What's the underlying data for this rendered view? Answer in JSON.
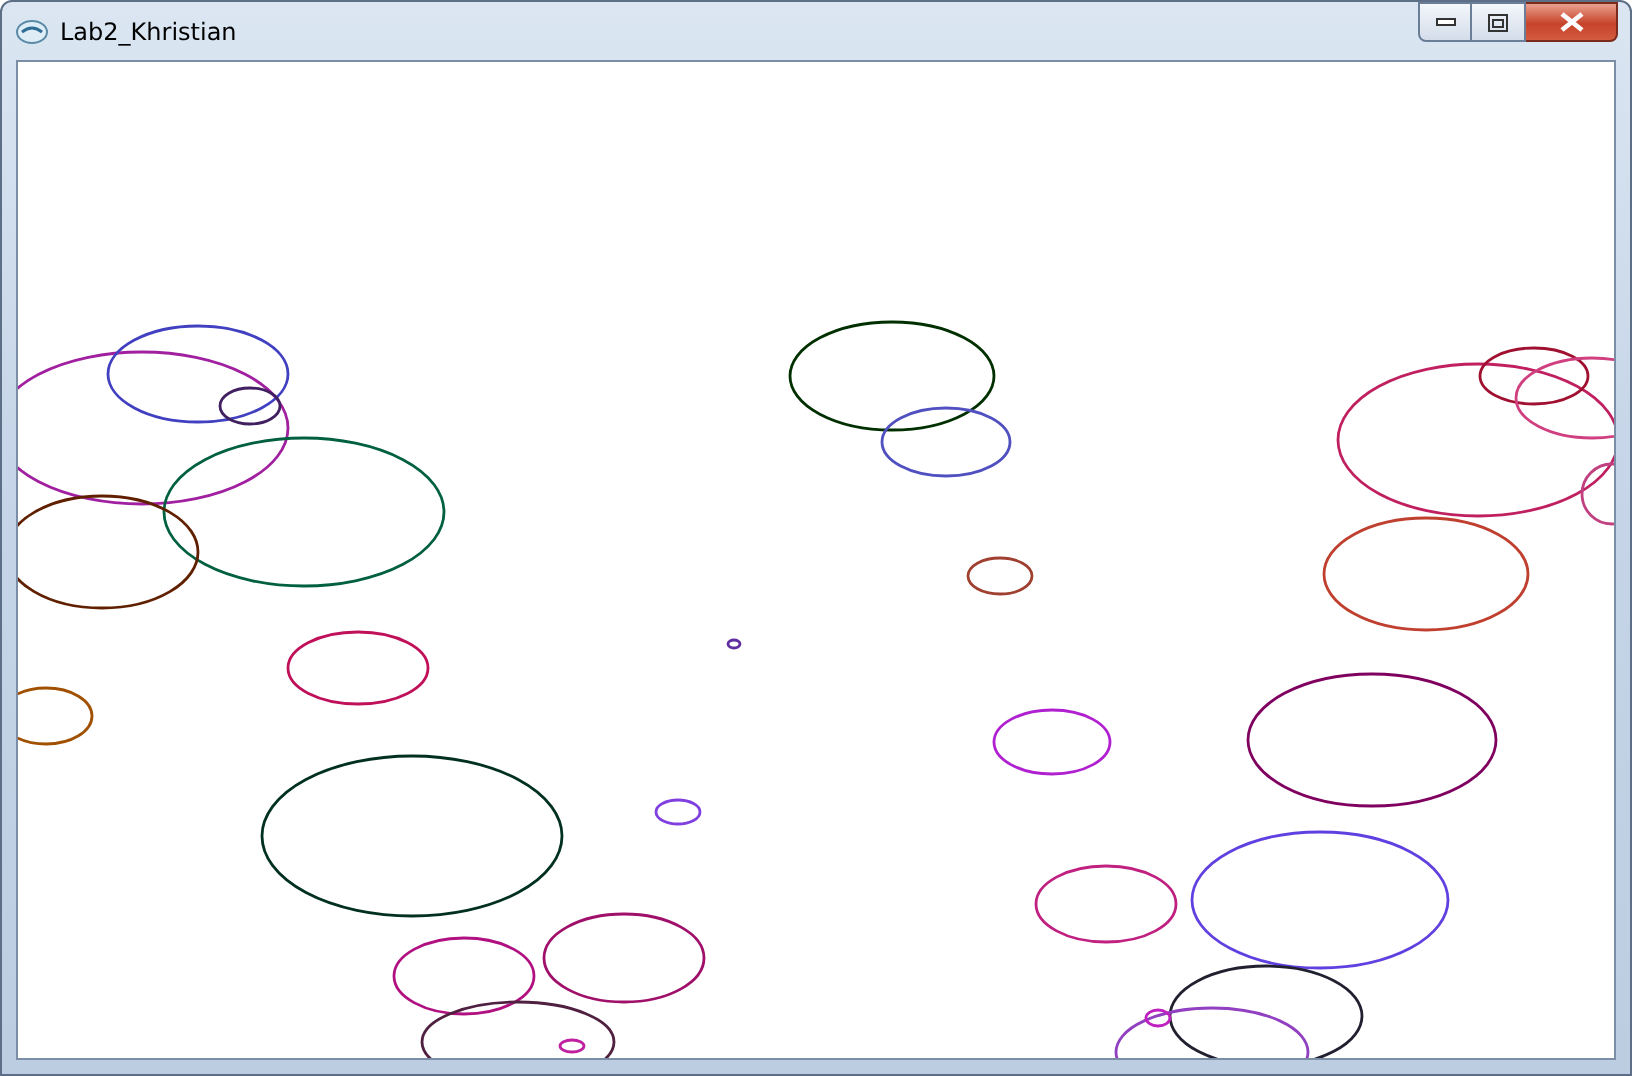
{
  "window": {
    "title": "Lab2_Khristian"
  }
}
